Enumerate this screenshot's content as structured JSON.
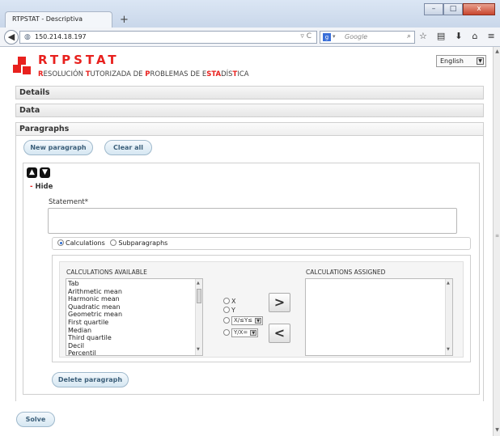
{
  "browser": {
    "tab_title": "RTPSTAT - Descriptiva",
    "new_tab": "+",
    "url": "150.214.18.197",
    "search_placeholder": "Google",
    "search_engine": "g",
    "window_buttons": [
      "–",
      "□",
      "x"
    ]
  },
  "header": {
    "brand": "RTPSTAT",
    "subtitle_parts": [
      {
        "t": "R",
        "red": true
      },
      {
        "t": "ESOLUCIÓN ",
        "red": false
      },
      {
        "t": "T",
        "red": true
      },
      {
        "t": "UTORIZADA DE ",
        "red": false
      },
      {
        "t": "P",
        "red": true
      },
      {
        "t": "ROBLEMAS DE E",
        "red": false
      },
      {
        "t": "STA",
        "red": true
      },
      {
        "t": "DÍS",
        "red": false
      },
      {
        "t": "T",
        "red": true
      },
      {
        "t": "ICA",
        "red": false
      }
    ],
    "language": "English"
  },
  "sections": {
    "details": "Details",
    "data": "Data",
    "paragraphs": "Paragraphs"
  },
  "buttons": {
    "new_paragraph": "New paragraph",
    "clear_all": "Clear all",
    "delete_paragraph": "Delete paragraph",
    "solve": "Solve"
  },
  "paragraph": {
    "hide_prefix": "- ",
    "hide_label": "Hide",
    "statement_label": "Statement*",
    "statement_value": "",
    "mode_calculations": "Calculations",
    "mode_subparagraphs": "Subparagraphs",
    "selected_mode": "Calculations"
  },
  "calculations": {
    "available_title": "CALCULATIONS AVAILABLE",
    "assigned_title": "CALCULATIONS ASSIGNED",
    "available": [
      "Tab",
      "Arithmetic mean",
      "Harmonic mean",
      "Quadratic mean",
      "Geometric mean",
      "First quartile",
      "Median",
      "Third quartile",
      "Decil",
      "Percentil"
    ],
    "assigned": [],
    "option_x": "X",
    "option_y": "Y",
    "option_x_select": "X/≤Y≤",
    "option_y_select": "Y/X=",
    "add_label": ">",
    "remove_label": "<"
  },
  "colors": {
    "brand_red": "#e8211e",
    "pill_text": "#3c5f7a"
  }
}
